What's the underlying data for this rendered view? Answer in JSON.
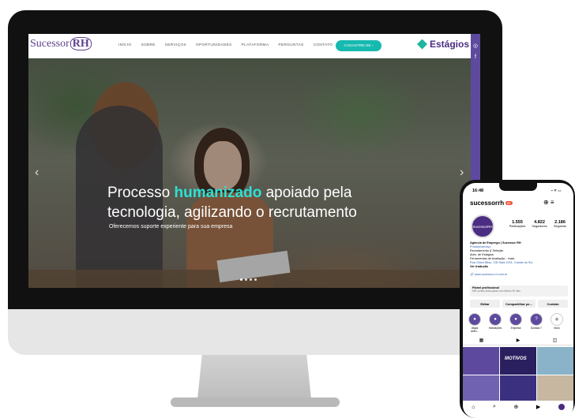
{
  "website": {
    "logo_text": "Sucessor",
    "logo_rh": "RH",
    "nav": [
      "INÍCIO",
      "SOBRE",
      "SERVIÇOS",
      "OPORTUNIDADES",
      "PLATAFORMA",
      "PERGUNTAS",
      "CONTATO"
    ],
    "cta_label": "CADASTRE-SE",
    "cta_arrow": "›",
    "estagios_label": "Estágios",
    "social": [
      "instagram-icon",
      "facebook-icon"
    ],
    "hero": {
      "title_before": "Processo ",
      "title_highlight": "humanizado",
      "title_after": " apoiado pela",
      "title_line2": "tecnologia, agilizando o recrutamento",
      "subtitle": "Oferecemos suporte experiente para sua empresa",
      "prev_arrow": "‹",
      "next_arrow": "›",
      "slides_count": 4,
      "active_slide": 1
    },
    "colors": {
      "brand_purple": "#5d3f8e",
      "cta_teal": "#16b9b0",
      "highlight_cyan": "#2fe0d4"
    }
  },
  "phone": {
    "time": "16:48",
    "status": "▪ ᯤ ▭",
    "handle": "sucessorrh",
    "handle_badge": "9+",
    "header_icons": "⊕  ≡",
    "avatar_text": "SucessorRH",
    "stats": [
      {
        "number": "1.555",
        "label": "Publicações"
      },
      {
        "number": "4.822",
        "label": "Seguidores"
      },
      {
        "number": "2.186",
        "label": "Seguindo"
      }
    ],
    "bio": {
      "name": "Agência de Emprego | Sucessor RH",
      "category": "Produto/serviço",
      "line1": "Recrutamento & Seleção",
      "line2": "Adm. de Estágios",
      "line3": "Ferramentas de Avaliação... mais",
      "address": "Rua Olavo Bilac, 135 Sala 1001, Caxias do Sul",
      "translate": "Ver tradução",
      "link": "🔗 www.sucessor-rh.com.br"
    },
    "panel_title": "Painel profissional",
    "panel_sub": "895 contas alcançadas nos últimos 30 dias.",
    "buttons": [
      "Editar",
      "Compartilhar pe...",
      "Contato"
    ],
    "highlights": [
      {
        "label": "Vagas Abert...",
        "icon": "●"
      },
      {
        "label": "Motivações",
        "icon": "●"
      },
      {
        "label": "Empresa",
        "icon": "●"
      },
      {
        "label": "Dúvidas ?",
        "icon": "?"
      },
      {
        "label": "Novo",
        "icon": "+"
      }
    ],
    "tab_icons": [
      "grid-icon",
      "reels-icon",
      "tagged-icon"
    ],
    "tab_glyphs": [
      "▦",
      "▶",
      "◫"
    ],
    "tile_text": "MOTIVOS",
    "bottom_nav": [
      "⌂",
      "⌕",
      "⊕",
      "▶"
    ]
  }
}
